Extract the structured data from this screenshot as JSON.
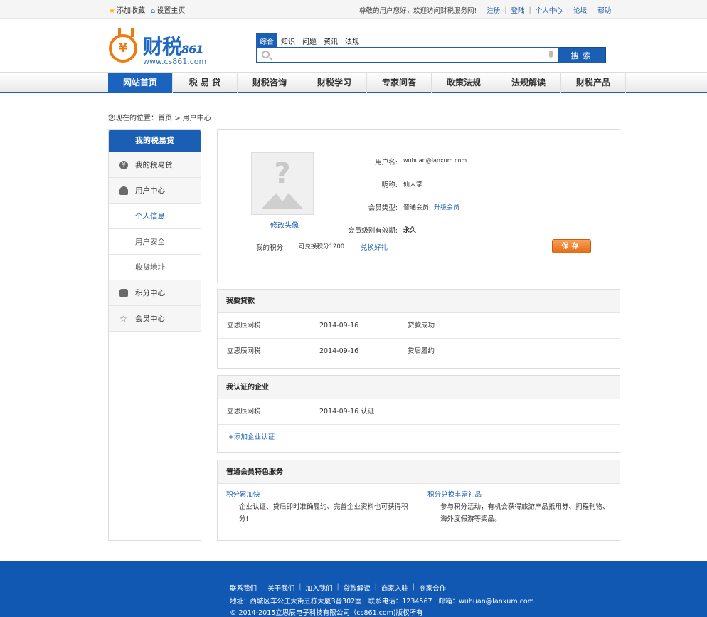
{
  "topbar": {
    "fav": "添加收藏",
    "sethome": "设置主页",
    "welcome": "尊敬的用户您好，欢迎访问财税服务网!",
    "links": [
      "注册",
      "登陆",
      "个人中心",
      "论坛",
      "帮助"
    ]
  },
  "logo": {
    "name": "财税",
    "num": "861",
    "url": "www.cs861.com",
    "coin_glyph": "¥"
  },
  "search": {
    "tabs": [
      "综合",
      "知识",
      "问题",
      "资讯",
      "法规"
    ],
    "active_tab": 0,
    "placeholder": "",
    "button": "搜索"
  },
  "nav": {
    "items": [
      "网站首页",
      "税 易 贷",
      "财税咨询",
      "财税学习",
      "专家问答",
      "政策法规",
      "法规解读",
      "财税产品"
    ],
    "active": 0
  },
  "breadcrumb": {
    "prefix": "您现在的位置：",
    "home": "首页",
    "arrow": ">",
    "current": "用户中心"
  },
  "sidebar": {
    "title": "我的税易贷",
    "items": [
      {
        "label": "我的税易贷",
        "icon": "yen-icon"
      },
      {
        "label": "用户中心",
        "icon": "user-icon"
      },
      {
        "label": "个人信息"
      },
      {
        "label": "用户安全"
      },
      {
        "label": "收货地址"
      },
      {
        "label": "积分中心",
        "icon": "coins-icon"
      },
      {
        "label": "会员中心",
        "icon": "star-icon"
      }
    ]
  },
  "profile": {
    "edit_avatar": "修改头像",
    "username_label": "用户名:",
    "username": "wuhuan@lanxum.com",
    "nickname_label": "昵称:",
    "nickname": "仙人掌",
    "member_type_label": "会员类型:",
    "member_type": "普通会员",
    "upgrade": "升级会员",
    "validity_label": "会员级别有效期:",
    "validity": "永久",
    "points_label": "我的积分",
    "points_exchange": "可兑换积分1200",
    "redeem": "兑换好礼",
    "save": "保存"
  },
  "loans": {
    "title": "我要贷款",
    "rows": [
      {
        "name": "立思辰网税",
        "date": "2014-09-16",
        "status": "贷款成功"
      },
      {
        "name": "立思辰网税",
        "date": "2014-09-16",
        "status": "贷后履约"
      }
    ]
  },
  "companies": {
    "title": "我认证的企业",
    "rows": [
      {
        "name": "立思辰网税",
        "date": "2014-09-16 认证"
      }
    ],
    "add": "+添加企业认证"
  },
  "services": {
    "title": "普通会员特色服务",
    "items": [
      {
        "title": "积分累加快",
        "desc": "企业认证、贷后即时准确履约、完善企业资料也可获得积分!"
      },
      {
        "title": "积分兑换丰富礼品",
        "desc": "参与积分活动，有机会获得旅游产品抵用券、拥程刊物、海外度假游等奖品。"
      }
    ]
  },
  "footer": {
    "links": [
      "联系我们",
      "关于我们",
      "加入我们",
      "贷款解读",
      "商家入驻",
      "商家合作"
    ],
    "address": "地址：西城区车公庄大街五栋大厦3音302室",
    "phone": "联系电话：1234567",
    "email": "邮箱：wuhuan@lanxum.com",
    "copyright": "© 2014-2015立思辰电子科技有限公司（cs861.com)版权所有"
  }
}
